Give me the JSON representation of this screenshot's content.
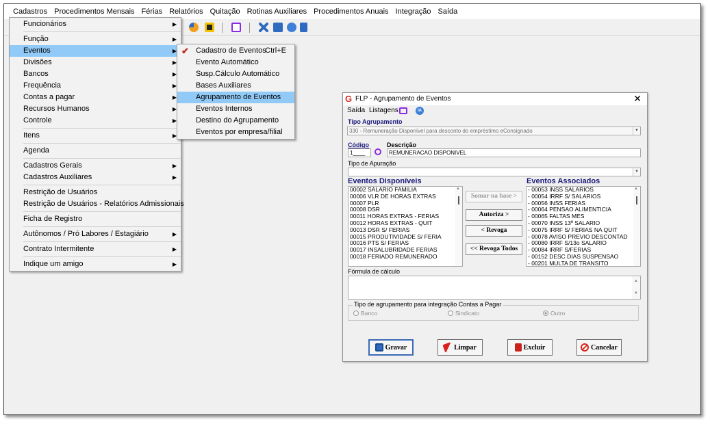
{
  "menubar": [
    "Cadastros",
    "Procedimentos Mensais",
    "Férias",
    "Relatórios",
    "Quitação",
    "Rotinas Auxiliares",
    "Procedimentos Anuais",
    "Integração",
    "Saída"
  ],
  "cadastros_menu": [
    {
      "label": "Funcionários",
      "arrow": true
    },
    {
      "sep": true
    },
    {
      "label": "Função",
      "arrow": true
    },
    {
      "label": "Eventos",
      "arrow": true,
      "highlight": true
    },
    {
      "label": "Divisões",
      "arrow": true
    },
    {
      "label": "Bancos",
      "arrow": true
    },
    {
      "label": "Frequência",
      "arrow": true
    },
    {
      "label": "Contas a pagar",
      "arrow": true
    },
    {
      "label": "Recursos Humanos",
      "arrow": true
    },
    {
      "label": "Controle",
      "arrow": true
    },
    {
      "sep": true
    },
    {
      "label": "Itens",
      "arrow": true
    },
    {
      "sep": true
    },
    {
      "label": "Agenda",
      "arrow": false
    },
    {
      "sep": true
    },
    {
      "label": "Cadastros Gerais",
      "arrow": true
    },
    {
      "label": "Cadastros Auxiliares",
      "arrow": true
    },
    {
      "sep": true
    },
    {
      "label": "Restrição de Usuários",
      "arrow": false
    },
    {
      "label": "Restrição de Usuários - Relatórios Admissionais",
      "arrow": false
    },
    {
      "sep": true
    },
    {
      "label": "Ficha de Registro",
      "arrow": false
    },
    {
      "sep": true
    },
    {
      "label": "Autônomos / Pró Labores / Estagiário",
      "arrow": true
    },
    {
      "sep": true
    },
    {
      "label": "Contrato Intermitente",
      "arrow": true
    },
    {
      "sep": true
    },
    {
      "label": "Indique um amigo",
      "arrow": true
    }
  ],
  "eventos_submenu": [
    {
      "label": "Cadastro de Eventos",
      "shortcut": "Ctrl+E",
      "checked": true
    },
    {
      "label": "Evento Automático"
    },
    {
      "label": "Susp.Cálculo Automático"
    },
    {
      "label": "Bases Auxiliares"
    },
    {
      "label": "Agrupamento de Eventos",
      "highlight": true
    },
    {
      "label": "Eventos Internos"
    },
    {
      "label": "Destino do Agrupamento"
    },
    {
      "label": "Eventos por empresa/filial"
    }
  ],
  "dialog": {
    "title": "FLP - Agrupamento de Eventos",
    "close": "✕",
    "menu_saida": "Saída",
    "menu_listagens": "Listagens",
    "ia_label": "IA",
    "tipo_agrupamento_label": "Tipo Agrupamento",
    "tipo_agrupamento_value": "330 - Remuneração Disponível para desconto do empréstimo eConsignado",
    "codigo_label": "Código",
    "codigo_value": "1____",
    "descricao_label": "Descrição",
    "descricao_value": "REMUNERACAO DISPONIVEL",
    "tipo_apuracao_label": "Tipo de Apuração",
    "tipo_apuracao_value": "",
    "disponiveis_label": "Eventos Disponíveis",
    "associados_label": "Eventos Associados",
    "disponiveis": [
      "00002 SALARIO FAMILIA",
      "00006 VLR DE HORAS EXTRAS",
      "00007 PLR",
      "00008 DSR",
      "00011 HORAS EXTRAS - FERIAS",
      "00012 HORAS EXTRAS - QUIT",
      "00013 DSR S/ FERIAS",
      "00015 PRODUTIVIDADE S/ FERIA",
      "00016 PTS S/ FERIAS",
      "00017 INSALUBRIDADE FERIAS",
      "00018 FERIADO REMUNERADO"
    ],
    "associados": [
      "- 00053 INSS  SALARIOS",
      "- 00054 IRRF S/ SALARIOS",
      "- 00056 INSS FERIAS",
      "- 00064 PENSAO ALIMENTICIA",
      "- 00065 FALTAS MES",
      "- 00070 INSS 13º SALARIO",
      "- 00075 IRRF S/ FERIAS NA QUIT",
      "- 00078 AVISO PREVIO DESCONTAD",
      "- 00080 IRRF S/13o SALARIO",
      "- 00084 IRRF S/FERIAS",
      "- 00152 DESC DIAS SUSPENSAO",
      "- 00201 MULTA DE TRANSITO"
    ],
    "btn_somar": "Somar na base >",
    "btn_autoriza": "Autoriza >",
    "btn_revoga": "< Revoga",
    "btn_revoga_todos": "<< Revoga Todos",
    "formula_label": "Fórmula de cálculo",
    "formula_value": "",
    "group_label": "Tipo de agrupamento para integração Contas a Pagar",
    "radio_banco": "Banco",
    "radio_sindicato": "Sindicato",
    "radio_outro": "Outro",
    "btn_gravar": "Gravar",
    "btn_limpar": "Limpar",
    "btn_excluir": "Excluir",
    "btn_cancelar": "Cancelar"
  },
  "colors": {
    "highlight": "#91c9f7",
    "title_blue": "#1a1a7a",
    "check_red": "#c0281e"
  }
}
